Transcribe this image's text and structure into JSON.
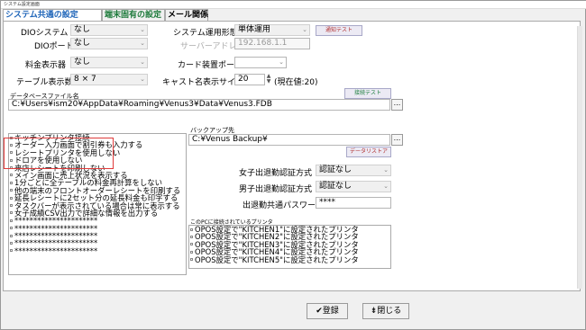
{
  "window": {
    "title": "システム設定画面"
  },
  "tabs": [
    {
      "label": "システム共通の設定"
    },
    {
      "label": "端末固有の設定"
    },
    {
      "label": "メール関係"
    }
  ],
  "dio_system": {
    "label": "DIOシステム",
    "value": "なし"
  },
  "dio_port": {
    "label": "DIOポート",
    "value": "なし"
  },
  "fee_display": {
    "label": "料金表示器",
    "value": "なし"
  },
  "table_display": {
    "label": "テーブル表示数",
    "value": "8 × 7"
  },
  "system_mode": {
    "label": "システム運用形態",
    "value": "単体運用"
  },
  "notify_test": {
    "label": "通知テスト"
  },
  "server_address": {
    "label": "サーバーアドレス",
    "value": "192.168.1.1"
  },
  "card_port": {
    "label": "カード装置ポート",
    "value": ""
  },
  "cast_name_size": {
    "label": "キャスト名表示サイズ",
    "value": "20",
    "note": "(現在値:20)"
  },
  "database": {
    "label": "データベースファイル名",
    "path": "C:¥Users¥ism20¥AppData¥Roaming¥Venus3¥Data¥Venus3.FDB",
    "test_label": "接続テスト",
    "browse": "..."
  },
  "backup": {
    "label": "バックアップ先",
    "path": "C:¥Venus Backup¥",
    "browse": "...",
    "restore_label": "データリストア"
  },
  "options": [
    "キッチンプリンタ接続",
    "オーダー入力画面で割引券も入力する",
    "レシートプリンタを使用しない",
    "ドロアを使用しない",
    "来店レシートを印刷しない",
    "メイン画面に売上状況を表示する",
    "1分ごとに全テーブルの料金再計算をしない",
    "他の端末のフロントオーダーレシートを印刷する",
    "延長レシートに2セット分の延長料金も印字する",
    "タスクバーが表示されている場合は常に表示する",
    "女子成績CSV出力で詳細な情報を出力する",
    "**********************",
    "**********************",
    "**********************",
    "**********************",
    "**********************"
  ],
  "female_auth": {
    "label": "女子出退勤認証方式",
    "value": "認証なし"
  },
  "male_auth": {
    "label": "男子出退勤認証方式",
    "value": "認証なし"
  },
  "attendance_password": {
    "label": "出退勤共通パスワード",
    "value": "****"
  },
  "printers": {
    "label": "このPCに接続されているプリンタ",
    "items": [
      "OPOS設定で\"KITCHEN1\"に設定されたプリンタ",
      "OPOS設定で\"KITCHEN2\"に設定されたプリンタ",
      "OPOS設定で\"KITCHEN3\"に設定されたプリンタ",
      "OPOS設定で\"KITCHEN4\"に設定されたプリンタ",
      "OPOS設定で\"KITCHEN5\"に設定されたプリンタ"
    ]
  },
  "footer": {
    "register_label": "✔登録",
    "close_label": "⇟閉じる"
  }
}
